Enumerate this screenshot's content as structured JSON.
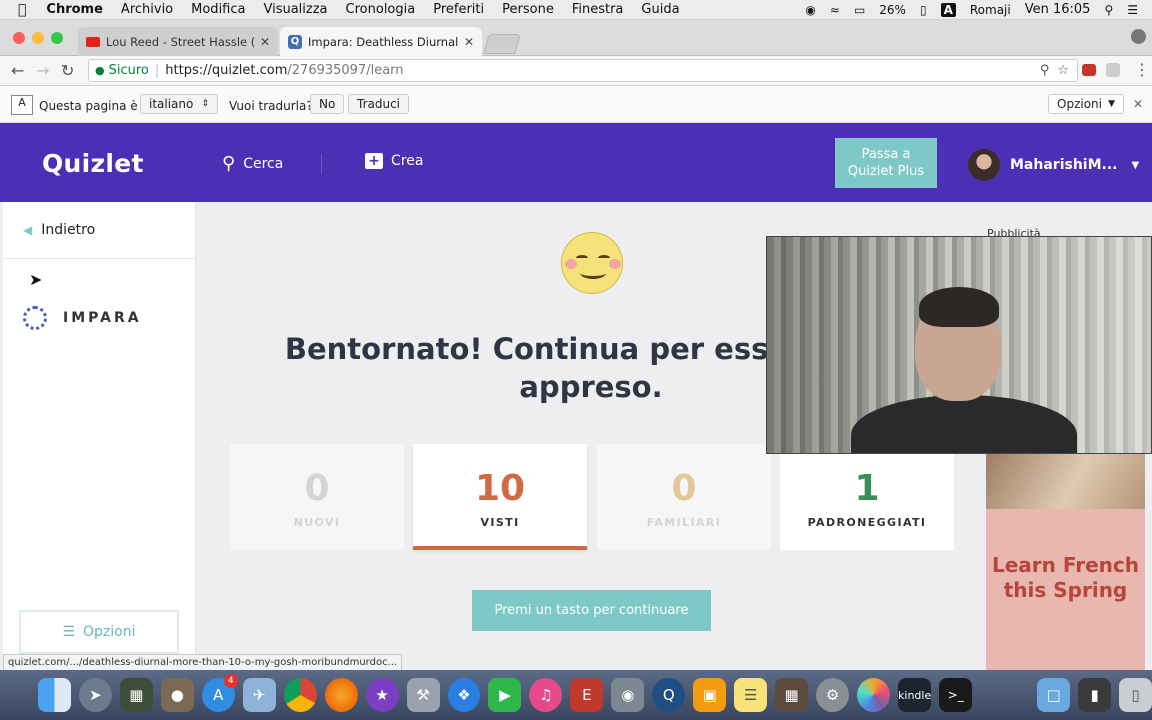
{
  "menubar": {
    "apple": "",
    "app": "Chrome",
    "items": [
      "Archivio",
      "Modifica",
      "Visualizza",
      "Cronologia",
      "Preferiti",
      "Persone",
      "Finestra",
      "Guida"
    ],
    "battery": "26%",
    "input_source": "Romaji",
    "clock": "Ven 16:05"
  },
  "tabs": [
    {
      "title": "Lou Reed - Street Hassle (Full",
      "icon": "youtube-icon",
      "active": false
    },
    {
      "title": "Impara: Deathless Diurnal: Mo",
      "icon": "quizlet-icon",
      "active": true
    }
  ],
  "address": {
    "secure": "Sicuro",
    "url_domain": "https://quizlet.com",
    "url_path": "/276935097/learn"
  },
  "translate": {
    "prompt": "Questa pagina è in",
    "language": "italiano",
    "question": "Vuoi tradurla?",
    "no": "No",
    "translate": "Traduci",
    "options": "Opzioni"
  },
  "header": {
    "logo": "Quizlet",
    "search": "Cerca",
    "create": "Crea",
    "plus_line1": "Passa a",
    "plus_line2": "Quizlet Plus",
    "username": "MaharishiM..."
  },
  "sidebar": {
    "back": "Indietro",
    "mode": "IMPARA",
    "options": "Opzioni"
  },
  "main": {
    "message_line1": "Bentornato! Continua per essere cert",
    "message_line2": "appreso.",
    "cards": [
      {
        "value": "0",
        "label": "NUOVI",
        "color": "#d4d4d4"
      },
      {
        "value": "10",
        "label": "VISTI",
        "color": "#d06a45"
      },
      {
        "value": "0",
        "label": "FAMILIARI",
        "color": "#e2c79a"
      },
      {
        "value": "1",
        "label": "PADRONEGGIATI",
        "color": "#3b8f58"
      }
    ],
    "continue": "Premi un tasto per continuare"
  },
  "ad": {
    "label": "Pubblicità",
    "line1": "Learn French",
    "line2": "this Spring"
  },
  "status_url": "quizlet.com/.../deathless-diurnal-more-than-10-o-my-gosh-moribundmurdoc...",
  "dock": [
    "finder-icon",
    "launchpad-icon",
    "photo-booth-icon",
    "gimp-icon",
    "app-store-icon",
    "preview-icon",
    "chrome-icon",
    "firefox-icon",
    "imovie-icon",
    "xcode-icon",
    "safari-icon",
    "facetime-icon",
    "itunes-icon",
    "everyday-icon",
    "image-capture-icon",
    "quicktime-icon",
    "ibooks-icon",
    "notes-icon",
    "photo-slideshow-icon",
    "system-preferences-icon",
    "photos-icon",
    "kindle-icon",
    "terminal-icon",
    "folder-icon",
    "archive-icon",
    "trash-icon"
  ],
  "dock_badge": "4",
  "dock_kindle": "kindle"
}
